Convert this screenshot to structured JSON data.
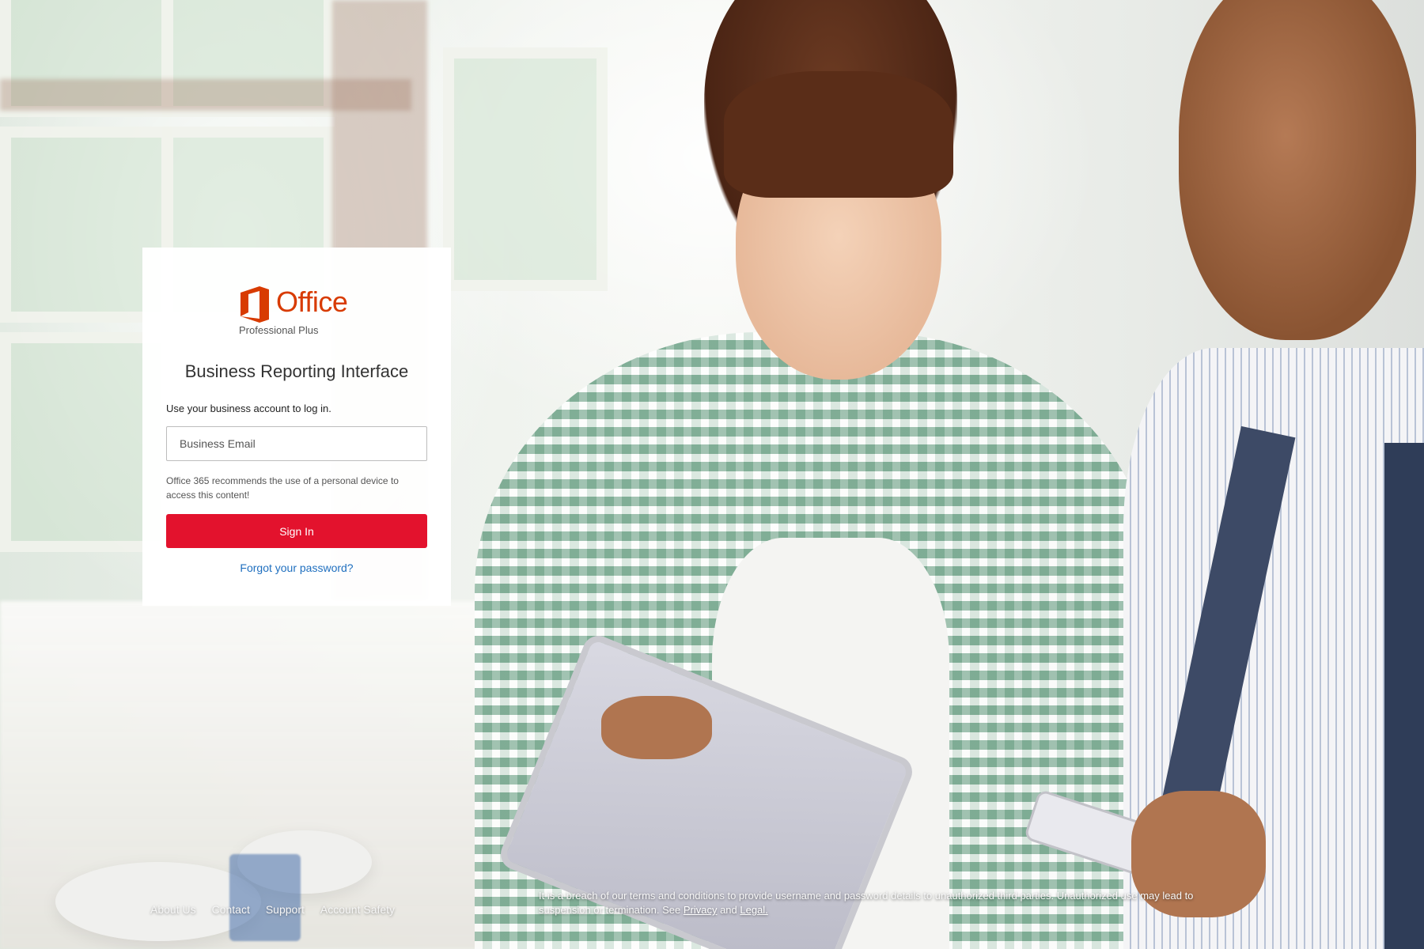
{
  "logo": {
    "brand": "Office",
    "edition": "Professional Plus",
    "accent_color": "#d83b01"
  },
  "login": {
    "title": "Business Reporting Interface",
    "instruction": "Use your business account to log in.",
    "email_placeholder": "Business Email",
    "email_value": "",
    "note": "Office 365 recommends the use of a personal device to access this content!",
    "signin_label": "Sign In",
    "signin_color": "#e3122d",
    "forgot_label": "Forgot your password?"
  },
  "footer": {
    "links": [
      {
        "label": "About Us"
      },
      {
        "label": "Contact"
      },
      {
        "label": "Support"
      },
      {
        "label": "Account Safety"
      }
    ],
    "legal_prefix": "It is a breach of our terms and conditions to provide username and password details to unauthorized third parties. Unauthorized use may lead to suspension or termination. See ",
    "privacy_label": "Privacy",
    "and_label": " and ",
    "legal_label": "Legal."
  }
}
